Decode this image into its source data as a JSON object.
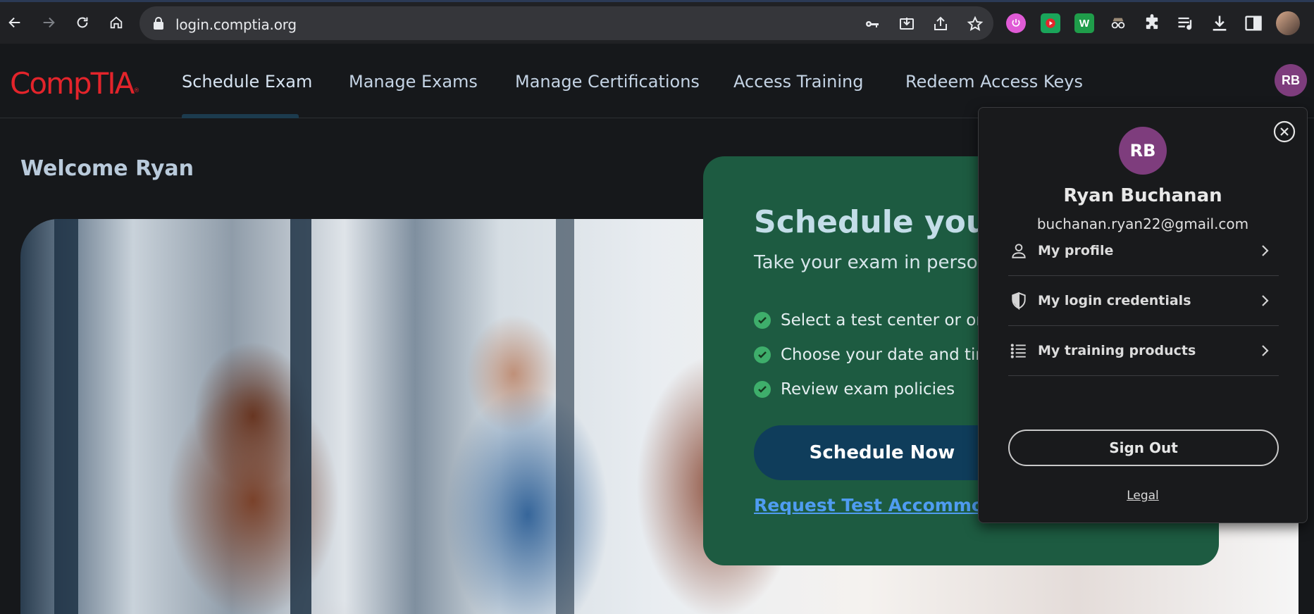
{
  "browser": {
    "url": "login.comptia.org",
    "extensions": [
      {
        "icon": "power-extension-icon",
        "color": "#e05bd6"
      },
      {
        "icon": "play-extension-icon",
        "color": "#1aa55a"
      },
      {
        "icon": "w-extension-icon",
        "label": "W",
        "color": "#1f9d4a"
      },
      {
        "icon": "spy-extension-icon",
        "color": "#7a6a5a"
      }
    ]
  },
  "site": {
    "logo": "CompTIA",
    "logo_mark": "®",
    "nav": [
      {
        "label": "Schedule Exam",
        "active": true
      },
      {
        "label": "Manage Exams"
      },
      {
        "label": "Manage Certifications"
      },
      {
        "label": "Access Training"
      },
      {
        "label": "Redeem Access Keys"
      }
    ],
    "avatar_initials": "RB",
    "avatar_color": "#7e3d7d"
  },
  "main": {
    "welcome": "Welcome Ryan",
    "promo": {
      "title": "Schedule your",
      "subtitle": "Take your exam in person o",
      "checks": [
        "Select a test center or onl",
        "Choose your date and tim",
        "Review exam policies"
      ],
      "cta": "Schedule Now",
      "link": "Request Test Accommoda",
      "color": "#1d5b41"
    }
  },
  "profile_menu": {
    "initials": "RB",
    "name": "Ryan Buchanan",
    "email": "buchanan.ryan22@gmail.com",
    "items": [
      {
        "label": "My profile",
        "icon": "person-icon"
      },
      {
        "label": "My login credentials",
        "icon": "shield-icon"
      },
      {
        "label": "My training products",
        "icon": "list-icon"
      }
    ],
    "sign_out": "Sign Out",
    "legal": "Legal"
  }
}
